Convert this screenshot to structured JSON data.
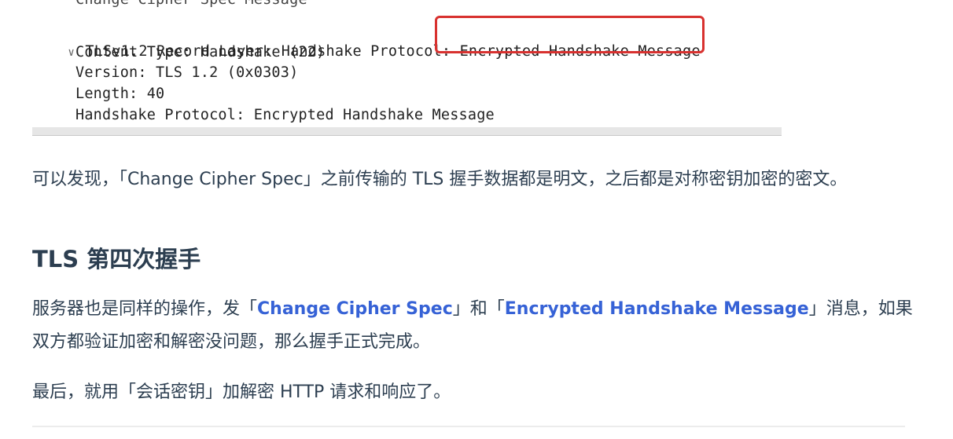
{
  "packet": {
    "cut_line": "Change Cipher Spec Message",
    "record_layer_prefix": "TLSv1.2 Record Layer: Handshake Protocol: ",
    "record_layer_highlight": "Encrypted Handshake Message",
    "content_type": "Content Type: Handshake (22)",
    "version": "Version: TLS 1.2 (0x0303)",
    "length": "Length: 40",
    "handshake_protocol": "Handshake Protocol: Encrypted Handshake Message",
    "highlight_color": "#d8312f"
  },
  "article": {
    "p1": "可以发现，「Change Cipher Spec」之前传输的 TLS 握手数据都是明文，之后都是对称密钥加密的密文。",
    "heading": "TLS 第四次握手",
    "p2_a": "服务器也是同样的操作，发「",
    "p2_link1": "Change Cipher Spec",
    "p2_b": "」和「",
    "p2_link2": "Encrypted Handshake Message",
    "p2_c": "」消息，如果双方都验证加密和解密没问题，那么握手正式完成。",
    "p3": "最后，就用「会话密钥」加解密 HTTP 请求和响应了。",
    "link_color": "#3662d6"
  }
}
